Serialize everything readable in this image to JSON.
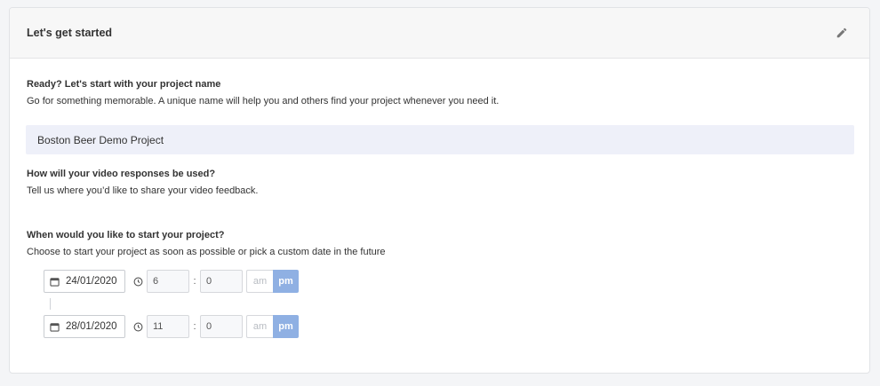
{
  "header": {
    "title": "Let's get started",
    "edit_icon": "pencil-icon"
  },
  "project_name": {
    "title": "Ready? Let's start with your project name",
    "description": "Go for something memorable. A unique name will help you and others find your project whenever you need it.",
    "value": "Boston Beer Demo Project"
  },
  "video_usage": {
    "title": "How will your video responses be used?",
    "description": "Tell us where you’d like to share your video feedback."
  },
  "schedule": {
    "title": "When would you like to start your project?",
    "description": "Choose to start your project as soon as possible or pick a custom date in the future",
    "start": {
      "date": "24/01/2020",
      "hour": "6",
      "minute": "0",
      "am_label": "am",
      "pm_label": "pm",
      "selected": "pm"
    },
    "end": {
      "date": "28/01/2020",
      "hour": "11",
      "minute": "0",
      "am_label": "am",
      "pm_label": "pm",
      "selected": "pm"
    },
    "separator": ":"
  },
  "colors": {
    "accent": "#8fb0e3",
    "input_bg": "#eef0f9"
  }
}
